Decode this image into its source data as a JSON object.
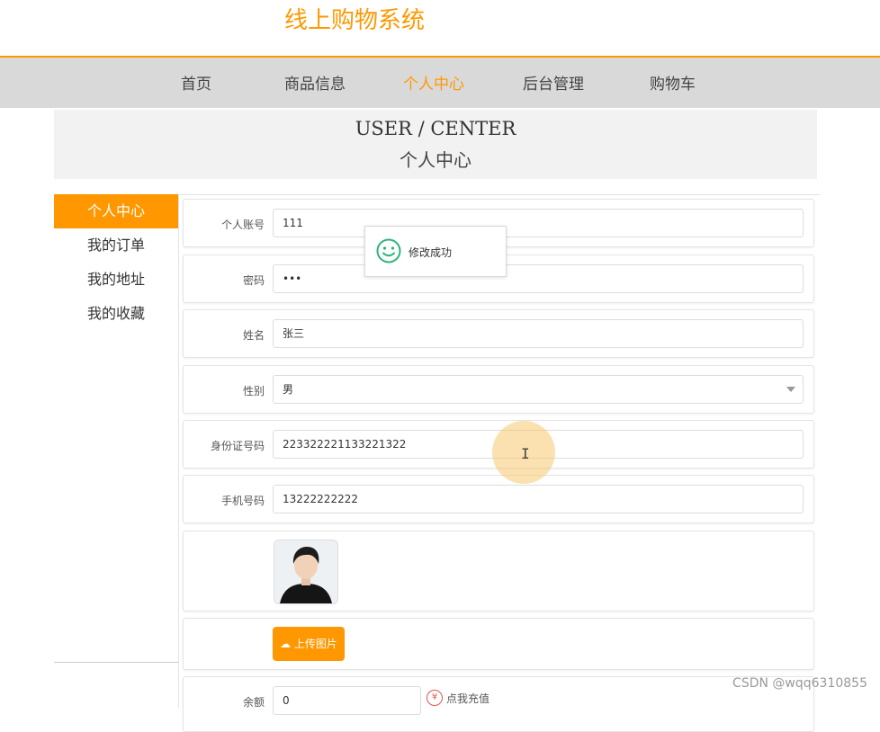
{
  "site": {
    "title": "线上购物系统"
  },
  "nav": {
    "items": [
      {
        "label": "首页"
      },
      {
        "label": "商品信息"
      },
      {
        "label": "个人中心"
      },
      {
        "label": "后台管理"
      },
      {
        "label": "购物车"
      }
    ],
    "active": "个人中心"
  },
  "banner": {
    "title_en": "USER / CENTER",
    "title_cn": "个人中心"
  },
  "sidebar": {
    "items": [
      {
        "label": "个人中心"
      },
      {
        "label": "我的订单"
      },
      {
        "label": "我的地址"
      },
      {
        "label": "我的收藏"
      }
    ]
  },
  "form": {
    "account": {
      "label": "个人账号",
      "value": "111"
    },
    "password": {
      "label": "密码",
      "value": "•••"
    },
    "name": {
      "label": "姓名",
      "value": "张三"
    },
    "gender": {
      "label": "性别",
      "value": "男"
    },
    "id_card": {
      "label": "身份证号码",
      "value": "223322221133221322"
    },
    "phone": {
      "label": "手机号码",
      "value": "13222222222"
    },
    "upload_label": "上传图片",
    "balance": {
      "label": "余额",
      "value": "0"
    },
    "recharge_label": "点我充值"
  },
  "toast": {
    "message": "修改成功"
  },
  "watermark": "CSDN @wqq6310855",
  "colors": {
    "accent": "#ff9800",
    "nav_bg": "#d9d9d9",
    "success": "#2db37a"
  },
  "icons": {
    "toast": "smile-icon",
    "upload": "cloud-upload-icon",
    "recharge": "yen-icon"
  }
}
